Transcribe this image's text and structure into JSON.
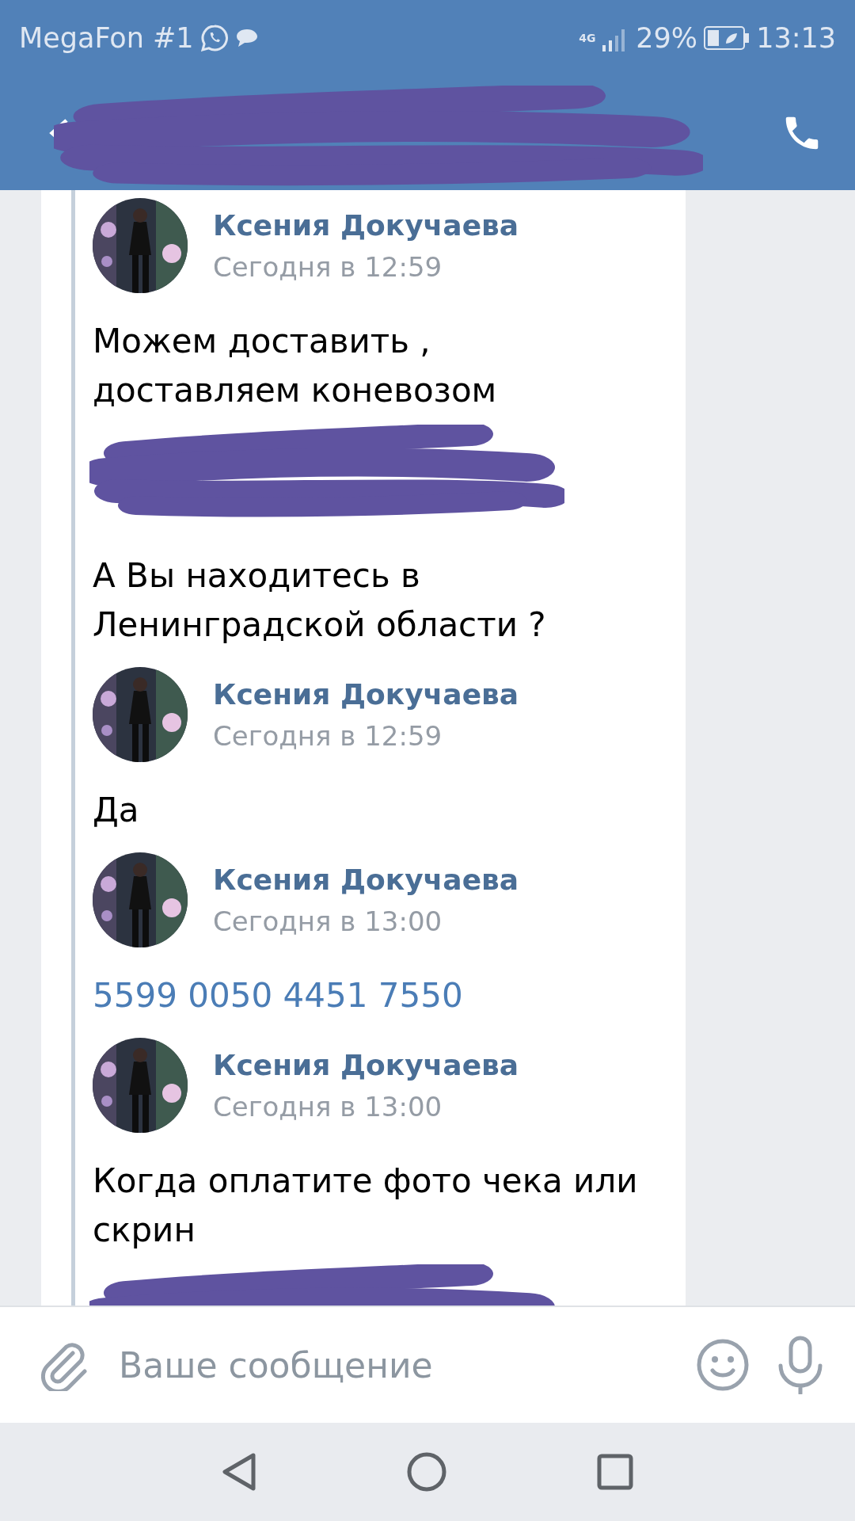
{
  "status_bar": {
    "carrier": "MegaFon #1",
    "network": "4G",
    "battery": "29%",
    "time": "13:13"
  },
  "messages": [
    {
      "kind": "message",
      "author": "Ксения Докучаева",
      "time": "Сегодня в 12:59",
      "text": "Можем доставить ,\nдоставляем коневозом"
    },
    {
      "kind": "redacted",
      "text": "А Вы находитесь в\nЛенинградской области ?"
    },
    {
      "kind": "message",
      "author": "Ксения Докучаева",
      "time": "Сегодня в 12:59",
      "text": "Да"
    },
    {
      "kind": "link",
      "author": "Ксения Докучаева",
      "time": "Сегодня в 13:00",
      "text": "5599 0050 4451 7550"
    },
    {
      "kind": "message",
      "author": "Ксения Докучаева",
      "time": "Сегодня в 13:00",
      "text": "Когда оплатите фото чека или\nскрин"
    },
    {
      "kind": "redacted"
    }
  ],
  "composer": {
    "placeholder": "Ваше сообщение"
  }
}
